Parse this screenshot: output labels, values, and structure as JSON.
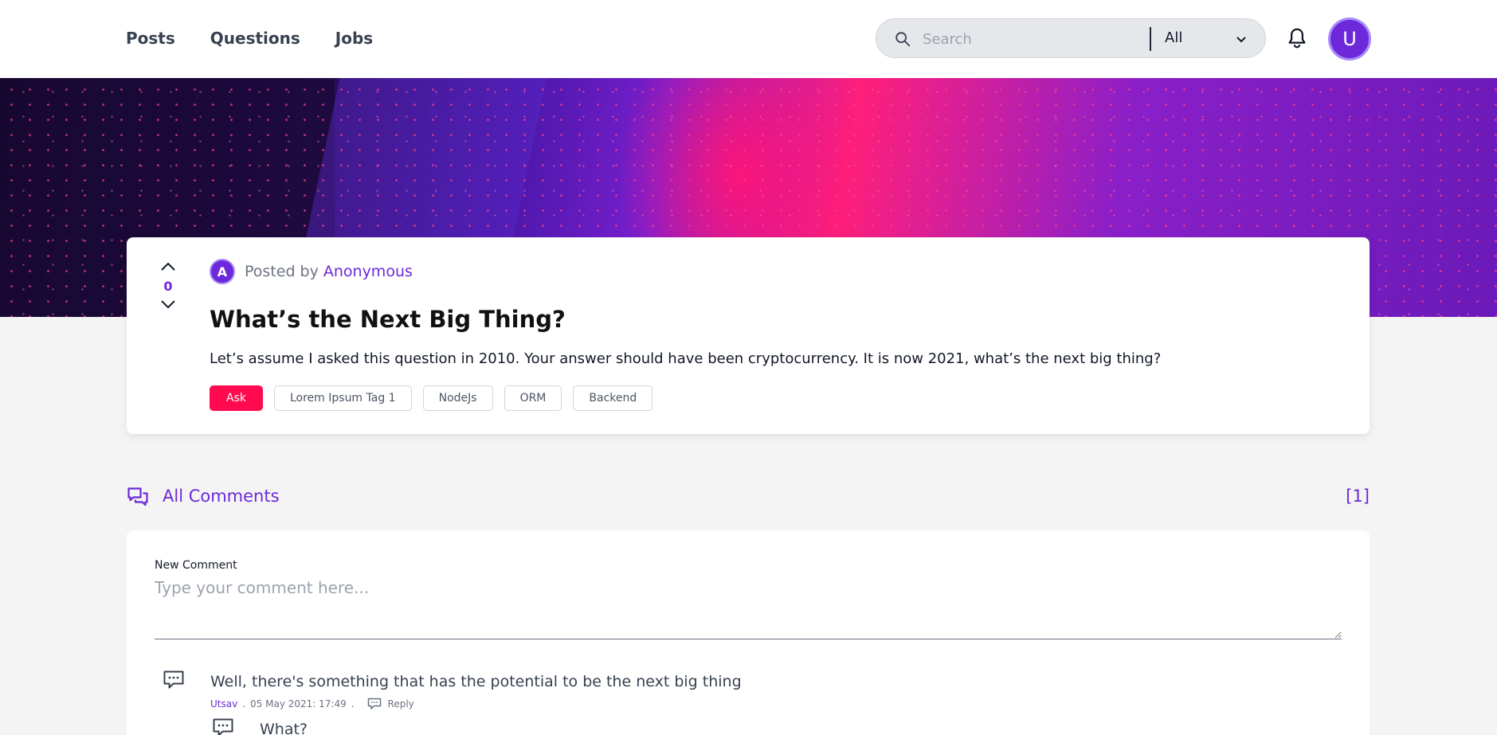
{
  "header": {
    "nav": [
      {
        "label": "Posts"
      },
      {
        "label": "Questions"
      },
      {
        "label": "Jobs"
      }
    ],
    "search": {
      "placeholder": "Search",
      "scope_value": "All"
    },
    "avatar_initial": "U"
  },
  "post": {
    "votes": "0",
    "author_initial": "A",
    "posted_by_label": "Posted by",
    "author": "Anonymous",
    "title": "What’s the Next Big Thing?",
    "body": "Let’s assume I asked this question in 2010. Your answer should have been cryptocurrency. It is now 2021, what’s the next big thing?",
    "tags": [
      {
        "label": "Ask",
        "primary": true
      },
      {
        "label": "Lorem Ipsum Tag 1"
      },
      {
        "label": "NodeJs"
      },
      {
        "label": "ORM"
      },
      {
        "label": "Backend"
      }
    ]
  },
  "comments": {
    "title": "All Comments",
    "count": "[1]",
    "new_comment_label": "New Comment",
    "new_comment_placeholder": "Type your comment here...",
    "items": [
      {
        "text": "Well, there's something that has the potential to be the next big thing",
        "author": "Utsav",
        "date": "05 May 2021: 17:49",
        "reply_label": "Reply",
        "replies": [
          {
            "text": "What?"
          }
        ]
      }
    ]
  },
  "colors": {
    "accent": "#6d28d9",
    "tag_primary": "#ff0a4e",
    "background": "#f4f4f5"
  }
}
